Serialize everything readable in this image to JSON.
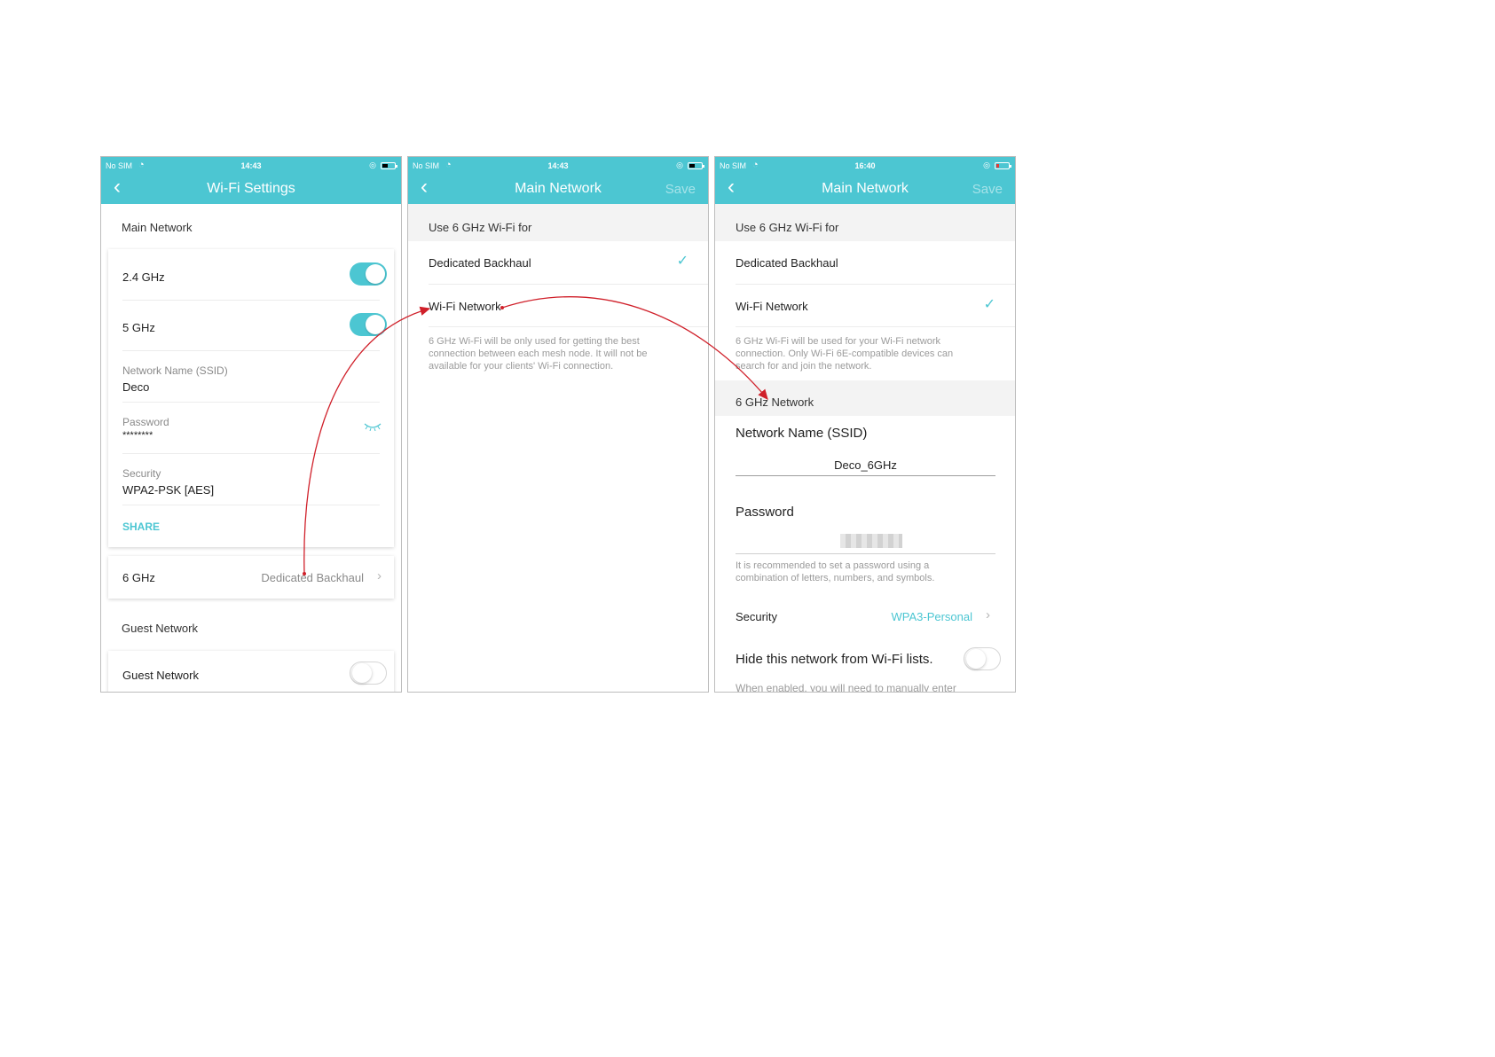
{
  "colors": {
    "accent": "#4cc6d2",
    "arrow": "#d0202a"
  },
  "screen1": {
    "status": {
      "carrier": "No SIM",
      "time": "14:43"
    },
    "title": "Wi-Fi Settings",
    "main_network_label": "Main Network",
    "band_24": "2.4 GHz",
    "band_5": "5 GHz",
    "ssid_label": "Network Name (SSID)",
    "ssid_value": "Deco",
    "password_label": "Password",
    "password_value": "********",
    "security_label": "Security",
    "security_value": "WPA2-PSK [AES]",
    "share": "SHARE",
    "band_6": "6 GHz",
    "band_6_value": "Dedicated Backhaul",
    "guest_label": "Guest Network",
    "guest_row": "Guest Network"
  },
  "screen2": {
    "status": {
      "carrier": "No SIM",
      "time": "14:43"
    },
    "title": "Main Network",
    "save": "Save",
    "use_label": "Use 6 GHz Wi-Fi for",
    "option_backhaul": "Dedicated Backhaul",
    "option_wifi": "Wi-Fi Network",
    "hint": "6 GHz Wi-Fi will be only used for getting the best connection between each mesh node. It will not be available for your clients' Wi-Fi connection."
  },
  "screen3": {
    "status": {
      "carrier": "No SIM",
      "time": "16:40"
    },
    "title": "Main Network",
    "save": "Save",
    "use_label": "Use 6 GHz Wi-Fi for",
    "option_backhaul": "Dedicated Backhaul",
    "option_wifi": "Wi-Fi Network",
    "hint": "6 GHz Wi-Fi will be used for your Wi-Fi network connection. Only Wi-Fi 6E-compatible devices can search for and join the network.",
    "network_section": "6 GHz Network",
    "ssid_label": "Network Name (SSID)",
    "ssid_value": "Deco_6GHz",
    "password_label": "Password",
    "password_hint": "It is recommended to set a password using a combination of letters, numbers, and symbols.",
    "security_label": "Security",
    "security_value": "WPA3-Personal",
    "hide_label": "Hide this network from Wi-Fi lists.",
    "hide_hint": "When enabled, you will need to manually enter"
  }
}
